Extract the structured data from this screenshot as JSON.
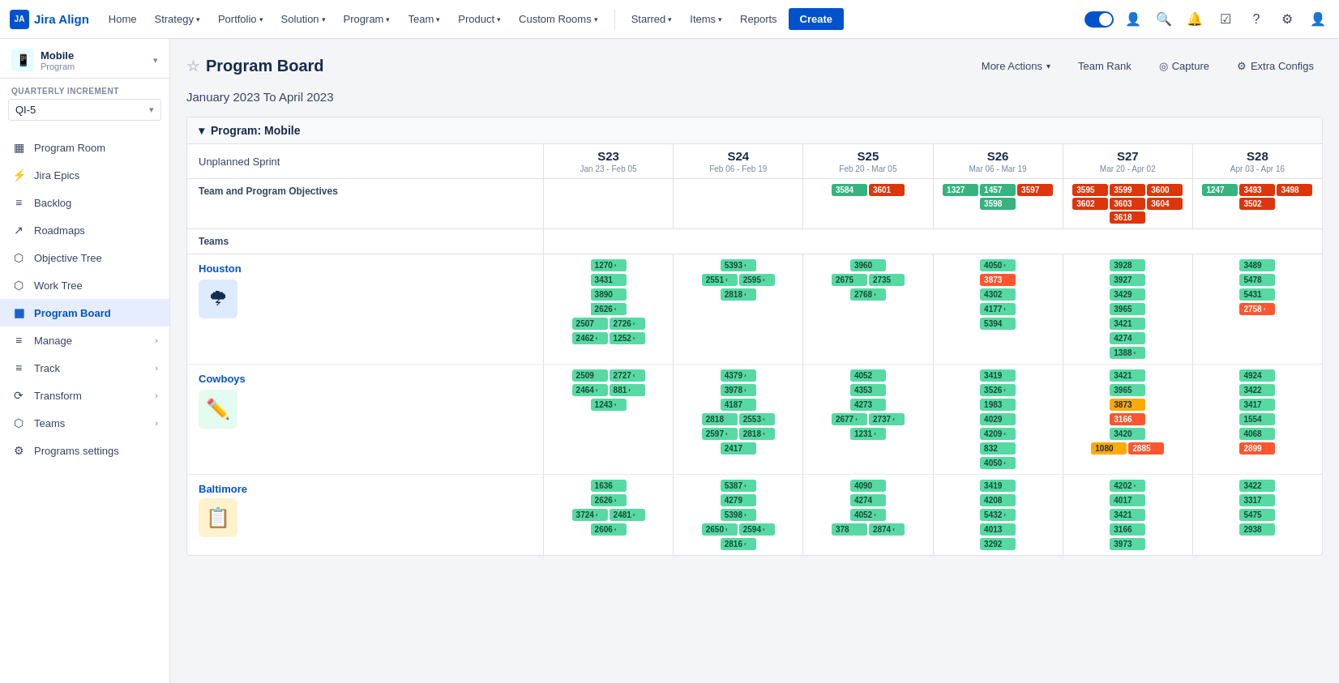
{
  "app": {
    "name": "Jira Align"
  },
  "topnav": {
    "logo": "Jira Align",
    "items": [
      "Home",
      "Strategy",
      "Portfolio",
      "Solution",
      "Program",
      "Team",
      "Product",
      "Custom Rooms",
      "Starred",
      "Items",
      "Reports"
    ],
    "create_label": "Create"
  },
  "sidebar": {
    "program_name": "Mobile",
    "program_type": "Program",
    "quarterly_label": "QUARTERLY INCREMENT",
    "qi_value": "QI-5",
    "nav_items": [
      {
        "label": "Program Room",
        "icon": "▦",
        "active": false
      },
      {
        "label": "Jira Epics",
        "icon": "⚡",
        "active": false
      },
      {
        "label": "Backlog",
        "icon": "≡",
        "active": false
      },
      {
        "label": "Roadmaps",
        "icon": "↗",
        "active": false
      },
      {
        "label": "Objective Tree",
        "icon": "⬡",
        "active": false
      },
      {
        "label": "Work Tree",
        "icon": "⬡",
        "active": false
      },
      {
        "label": "Program Board",
        "icon": "▦",
        "active": true
      },
      {
        "label": "Manage",
        "icon": "≡",
        "active": false,
        "expand": true
      },
      {
        "label": "Track",
        "icon": "≡",
        "active": false,
        "expand": true
      },
      {
        "label": "Transform",
        "icon": "⟳",
        "active": false,
        "expand": true
      },
      {
        "label": "Teams",
        "icon": "⬡",
        "active": false,
        "expand": true
      },
      {
        "label": "Programs settings",
        "icon": "⚙",
        "active": false
      }
    ]
  },
  "page": {
    "title": "Program Board",
    "date_range": "January 2023 To April 2023",
    "program_label": "Program: Mobile",
    "actions": {
      "more_actions": "More Actions",
      "team_rank": "Team Rank",
      "capture": "Capture",
      "extra_configs": "Extra Configs"
    }
  },
  "board": {
    "sprints": [
      {
        "name": "S23",
        "dates": "Jan 23 - Feb 05"
      },
      {
        "name": "S24",
        "dates": "Feb 06 - Feb 19"
      },
      {
        "name": "S25",
        "dates": "Feb 20 - Mar 05"
      },
      {
        "name": "S26",
        "dates": "Mar 06 - Mar 19"
      },
      {
        "name": "S27",
        "dates": "Mar 20 - Apr 02"
      },
      {
        "name": "S28",
        "dates": "Apr 03 - Apr 16"
      }
    ],
    "unplanned_label": "Unplanned Sprint",
    "objectives_label": "Team and Program Objectives",
    "teams_label": "Teams"
  },
  "colors": {
    "green": "#57d9a3",
    "red": "#ff5630",
    "orange": "#ff8b00",
    "yellow": "#ffab00",
    "accent": "#0052cc"
  }
}
